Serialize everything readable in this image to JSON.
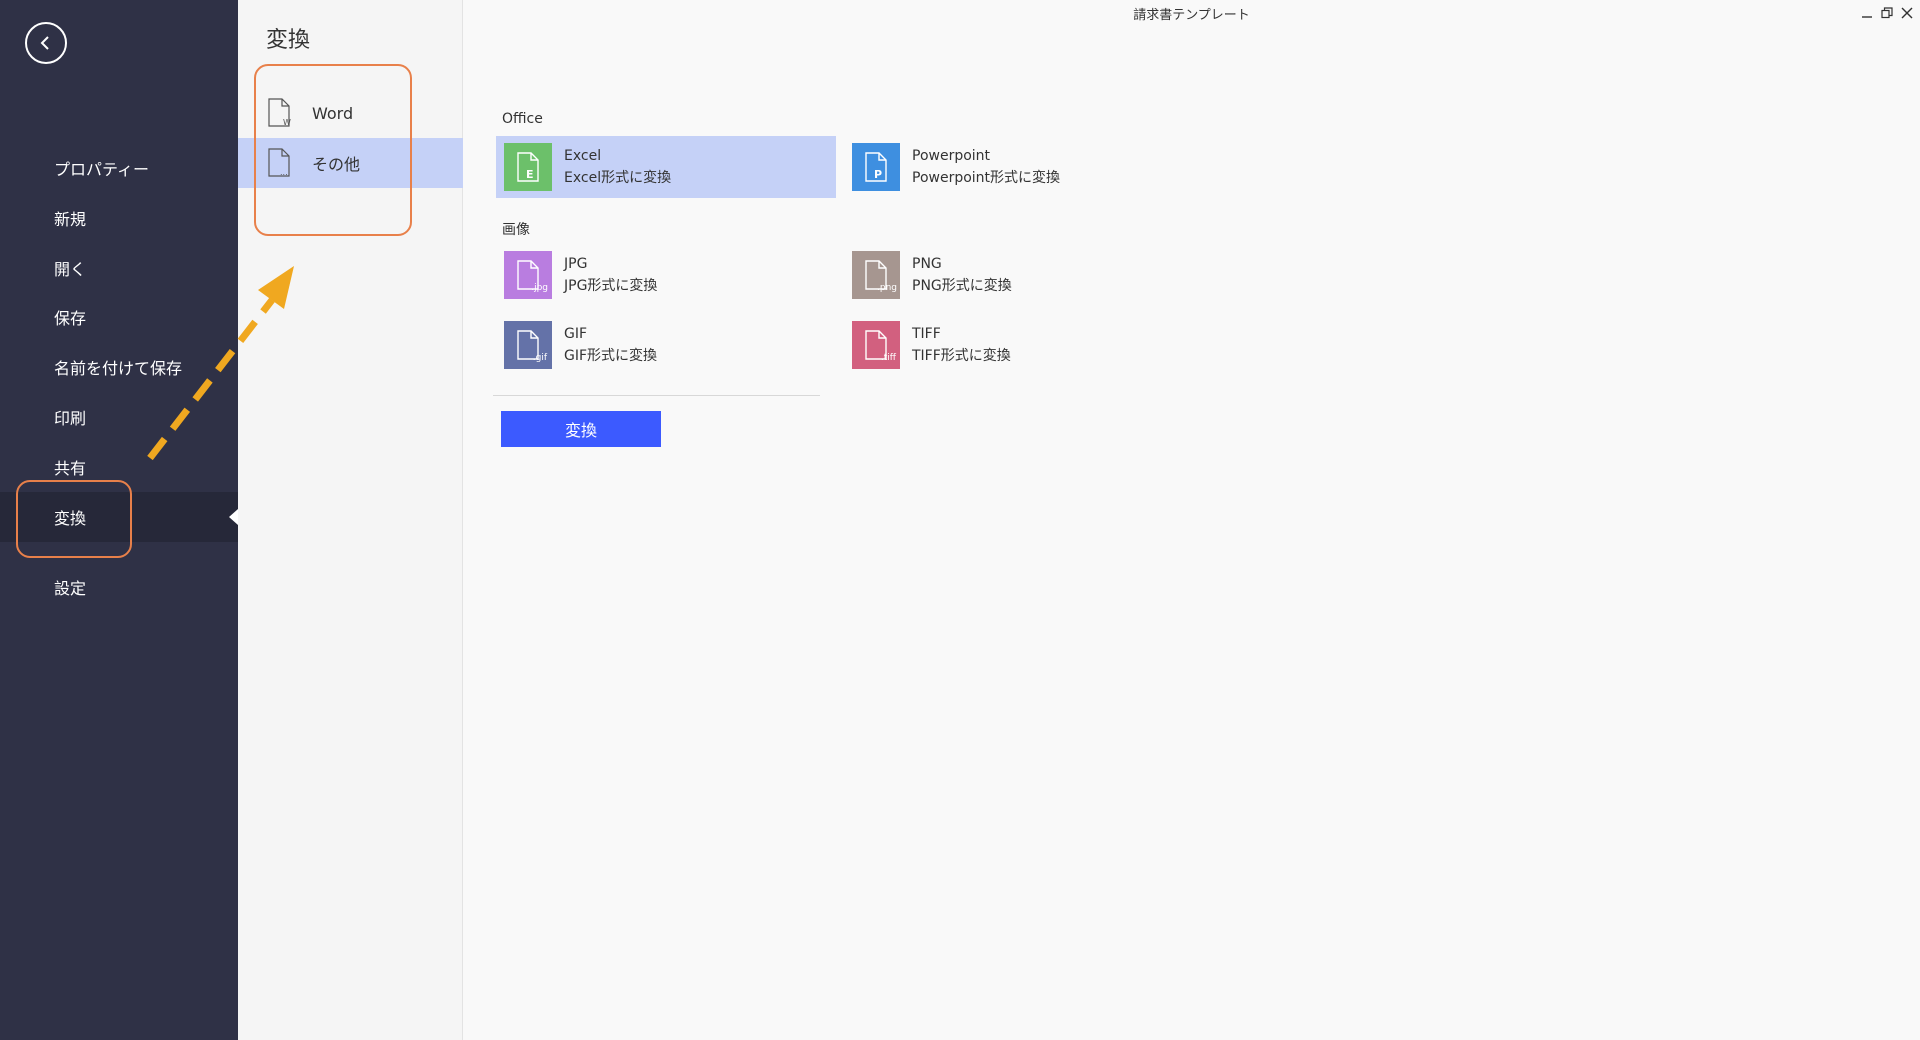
{
  "window": {
    "title": "請求書テンプレート"
  },
  "nav": {
    "items": [
      {
        "label": "プロパティー"
      },
      {
        "label": "新規"
      },
      {
        "label": "開く"
      },
      {
        "label": "保存"
      },
      {
        "label": "名前を付けて保存"
      },
      {
        "label": "印刷"
      },
      {
        "label": "共有"
      },
      {
        "label": "変換"
      },
      {
        "label": "設定"
      }
    ],
    "active": "変換"
  },
  "sub": {
    "title": "変換",
    "items": [
      {
        "label": "Word"
      },
      {
        "label": "その他"
      }
    ],
    "selected": "その他"
  },
  "main": {
    "sections": [
      {
        "label": "Office",
        "formats": [
          {
            "name": "Excel",
            "desc": "Excel形式に変換",
            "icon": "excel-icon",
            "color": "#6cc06a",
            "tag": "E"
          },
          {
            "name": "Powerpoint",
            "desc": "Powerpoint形式に変換",
            "icon": "powerpoint-icon",
            "color": "#3e8fe0",
            "tag": "P"
          }
        ]
      },
      {
        "label": "画像",
        "formats": [
          {
            "name": "JPG",
            "desc": "JPG形式に変換",
            "icon": "jpg-icon",
            "color": "#b97de0",
            "tag": ".jpg"
          },
          {
            "name": "PNG",
            "desc": "PNG形式に変換",
            "icon": "png-icon",
            "color": "#a69690",
            "tag": ".png"
          },
          {
            "name": "GIF",
            "desc": "GIF形式に変換",
            "icon": "gif-icon",
            "color": "#6472a8",
            "tag": ".gif"
          },
          {
            "name": "TIFF",
            "desc": "TIFF形式に変換",
            "icon": "tiff-icon",
            "color": "#d2607f",
            "tag": ".tiff"
          }
        ]
      }
    ],
    "selected_format": "Excel",
    "convert_label": "変換"
  },
  "colors": {
    "nav_bg": "#2f3146",
    "accent": "#3c5aff",
    "selected_bg": "#c5d1f7",
    "annotation": "#e8804a",
    "arrow": "#f0a820"
  }
}
